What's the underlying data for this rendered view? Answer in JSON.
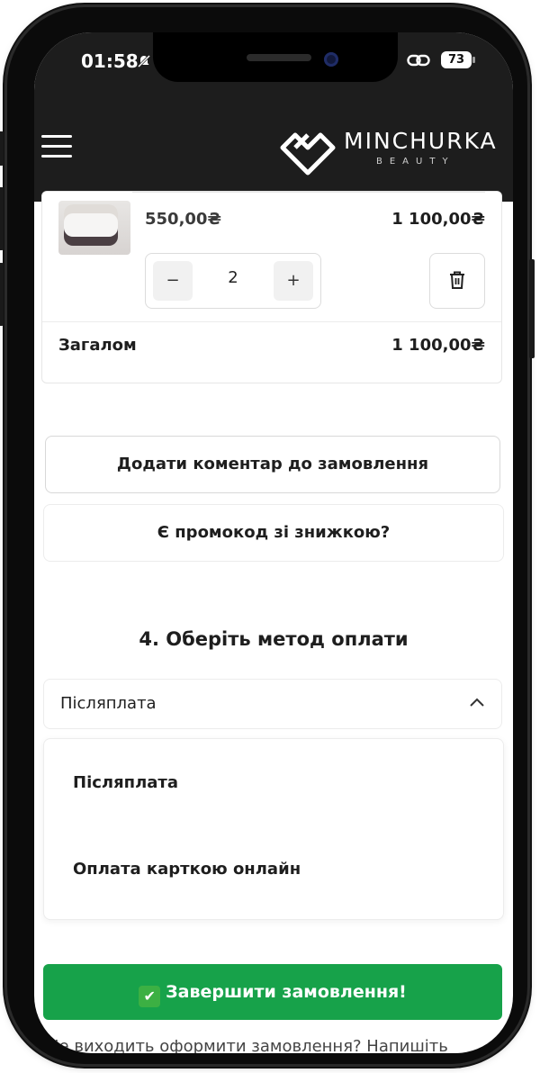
{
  "status_bar": {
    "time": "01:58",
    "battery": "73"
  },
  "header": {
    "brand": "MINCHURKA",
    "brand_sub": "BEAUTY"
  },
  "cart_item": {
    "unit_price": "550,00₴",
    "line_total": "1 100,00₴",
    "quantity": "2",
    "decrement": "−",
    "increment": "+"
  },
  "totals": {
    "label": "Загалом",
    "value": "1 100,00₴"
  },
  "actions": {
    "add_comment": "Додати коментар до замовлення",
    "promo": "Є промокод зі знижкою?"
  },
  "payment": {
    "title": "4. Оберіть метод оплати",
    "selected": "Післяплата",
    "options": [
      "Післяплата",
      "Оплата карткою онлайн"
    ]
  },
  "checkout": {
    "label": "Завершити замовлення!",
    "emoji": "✔"
  },
  "footer": {
    "note": "Не виходить оформити замовлення? Напишіть"
  },
  "colors": {
    "header_bg": "#1d1d1d",
    "cta_green": "#17a24a"
  },
  "icons": [
    "menu-icon",
    "brand-logo-icon",
    "trash-icon",
    "chevron-up-icon",
    "link-icon",
    "silent-bell-icon",
    "check-mark-icon"
  ]
}
